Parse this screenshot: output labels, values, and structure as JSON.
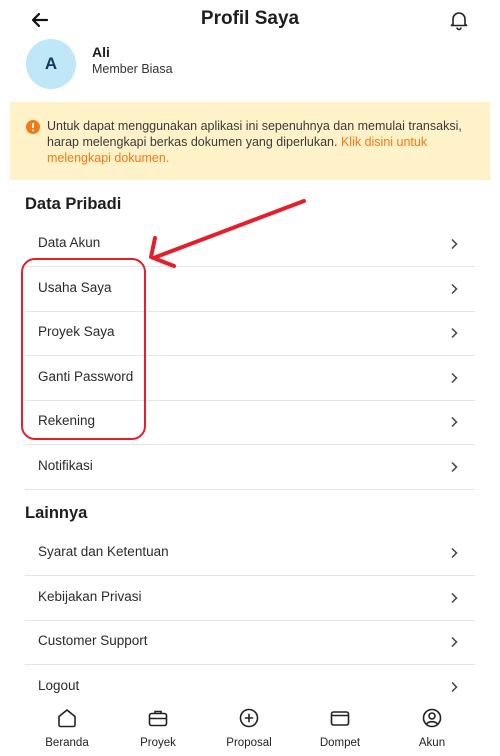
{
  "header": {
    "title": "Profil Saya",
    "back_icon": "back-arrow-icon",
    "bell_icon": "bell-icon"
  },
  "profile": {
    "avatar_initial": "A",
    "name": "Ali",
    "tier": "Member Biasa"
  },
  "warning": {
    "text": "Untuk dapat menggunakan aplikasi ini sepenuhnya dan memulai transaksi, harap melengkapi berkas dokumen yang diperlukan.",
    "link": "Klik disini untuk melengkapi dokumen.",
    "icon": "info-icon",
    "accent_color": "#f07a16",
    "background_color": "#fff1c8"
  },
  "sections": {
    "personal": {
      "title": "Data Pribadi",
      "items": [
        "Data Akun",
        "Usaha Saya",
        "Proyek Saya",
        "Ganti Password",
        "Rekening",
        "Notifikasi"
      ]
    },
    "other": {
      "title": "Lainnya",
      "items": [
        "Syarat dan Ketentuan",
        "Kebijakan Privasi",
        "Customer Support",
        "Logout"
      ]
    }
  },
  "annotation": {
    "color": "#e41e2b"
  },
  "bottom_nav": [
    {
      "label": "Beranda",
      "icon": "home-icon"
    },
    {
      "label": "Proyek",
      "icon": "briefcase-icon"
    },
    {
      "label": "Proposal",
      "icon": "plus-circle-icon"
    },
    {
      "label": "Dompet",
      "icon": "wallet-icon"
    },
    {
      "label": "Akun",
      "icon": "user-circle-icon"
    }
  ]
}
